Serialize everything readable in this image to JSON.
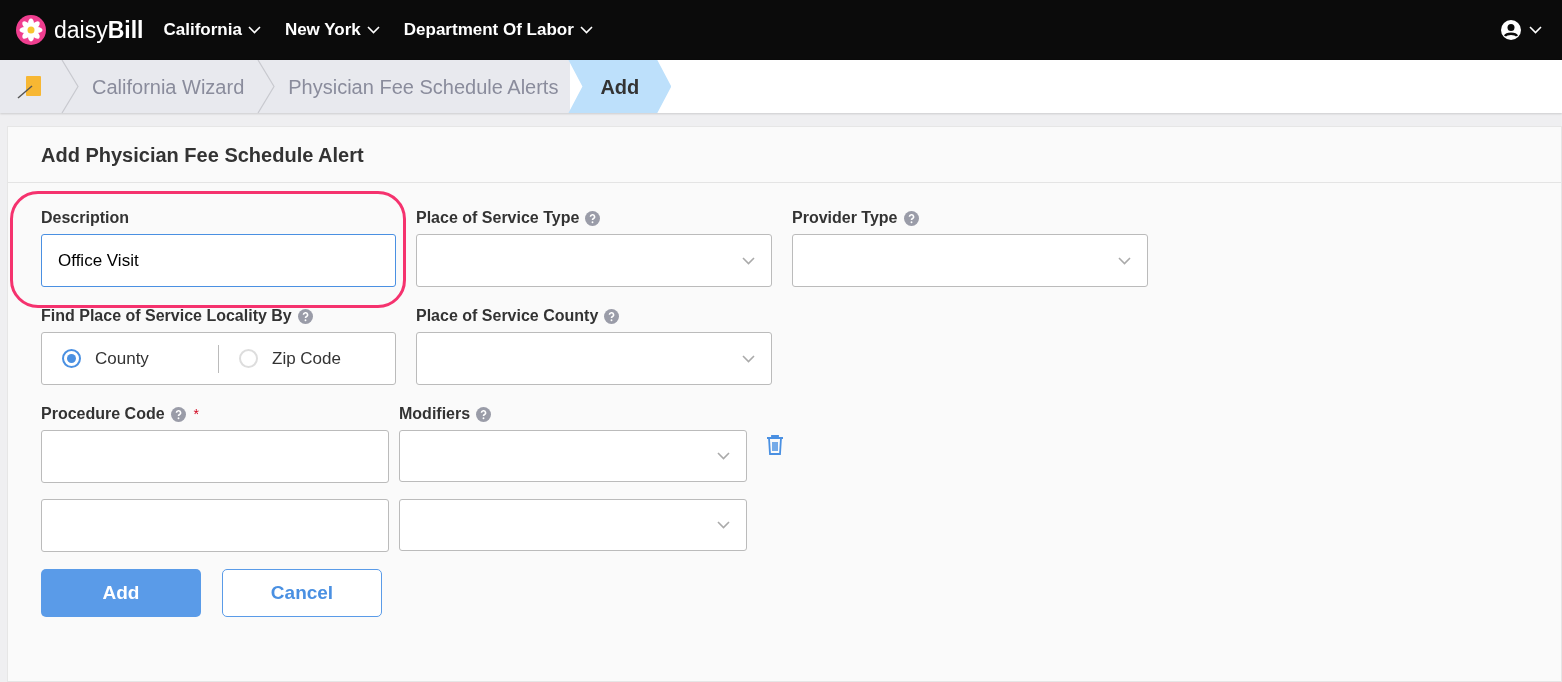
{
  "nav": {
    "brand": {
      "light": "daisy",
      "bold": "Bill"
    },
    "menus": [
      "California",
      "New York",
      "Department Of Labor"
    ]
  },
  "breadcrumb": [
    {
      "label": "California Wizard",
      "selected": false
    },
    {
      "label": "Physician Fee Schedule Alerts",
      "selected": false
    },
    {
      "label": "Add",
      "selected": true
    }
  ],
  "form": {
    "title": "Add Physician Fee Schedule Alert",
    "description": {
      "label": "Description",
      "value": "Office Visit",
      "highlighted": true
    },
    "place_of_service_type": {
      "label": "Place of Service Type"
    },
    "provider_type": {
      "label": "Provider Type"
    },
    "locality": {
      "label": "Find Place of Service Locality By",
      "options": [
        {
          "label": "County",
          "selected": true
        },
        {
          "label": "Zip Code",
          "selected": false
        }
      ]
    },
    "county": {
      "label": "Place of Service County"
    },
    "procedure_code": {
      "label": "Procedure Code",
      "required_mark": "*"
    },
    "modifiers": {
      "label": "Modifiers"
    },
    "code_rows": [
      {
        "deletable": true
      },
      {
        "deletable": false
      }
    ],
    "buttons": {
      "add": "Add",
      "cancel": "Cancel"
    }
  }
}
